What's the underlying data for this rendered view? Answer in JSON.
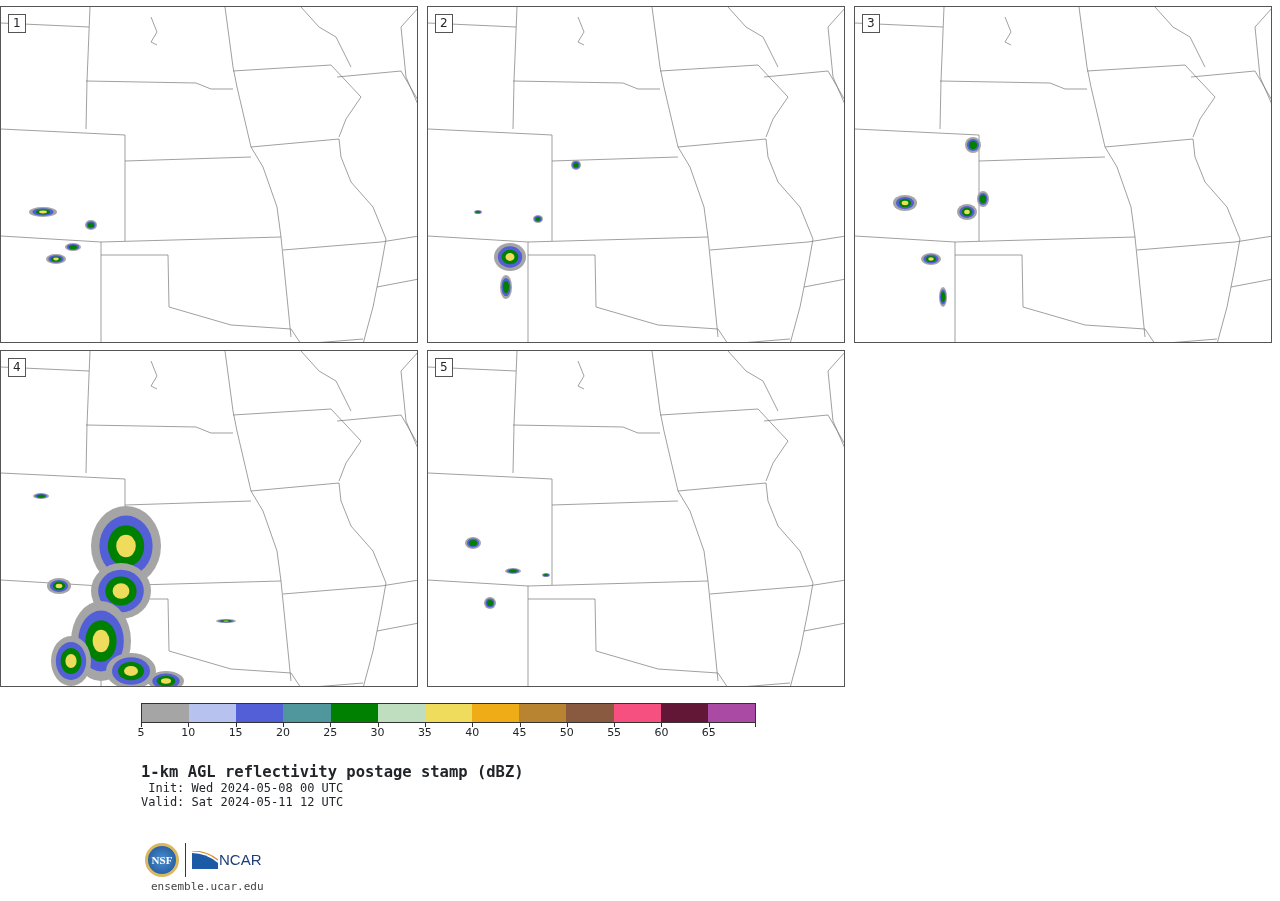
{
  "panels": [
    {
      "label": "1"
    },
    {
      "label": "2"
    },
    {
      "label": "3"
    },
    {
      "label": "4"
    },
    {
      "label": "5"
    }
  ],
  "colorbar": {
    "bins": [
      {
        "color": "#a5a5a5"
      },
      {
        "color": "#b8c2ef"
      },
      {
        "color": "#525fd6"
      },
      {
        "color": "#4f979d"
      },
      {
        "color": "#008000"
      },
      {
        "color": "#bfdebf"
      },
      {
        "color": "#efdb5c"
      },
      {
        "color": "#efac17"
      },
      {
        "color": "#b88431"
      },
      {
        "color": "#8a5a40"
      },
      {
        "color": "#f5507f"
      },
      {
        "color": "#621737"
      },
      {
        "color": "#ab4aa5"
      }
    ],
    "ticks": [
      "5",
      "10",
      "15",
      "20",
      "25",
      "30",
      "35",
      "40",
      "45",
      "50",
      "55",
      "60",
      "65"
    ]
  },
  "title": "1-km AGL reflectivity postage stamp (dBZ)",
  "init": " Init: Wed 2024-05-08 00 UTC",
  "valid": "Valid: Sat 2024-05-11 12 UTC",
  "logo": {
    "left": "NSF",
    "right": "NCAR"
  },
  "footer": "ensemble.ucar.edu"
}
